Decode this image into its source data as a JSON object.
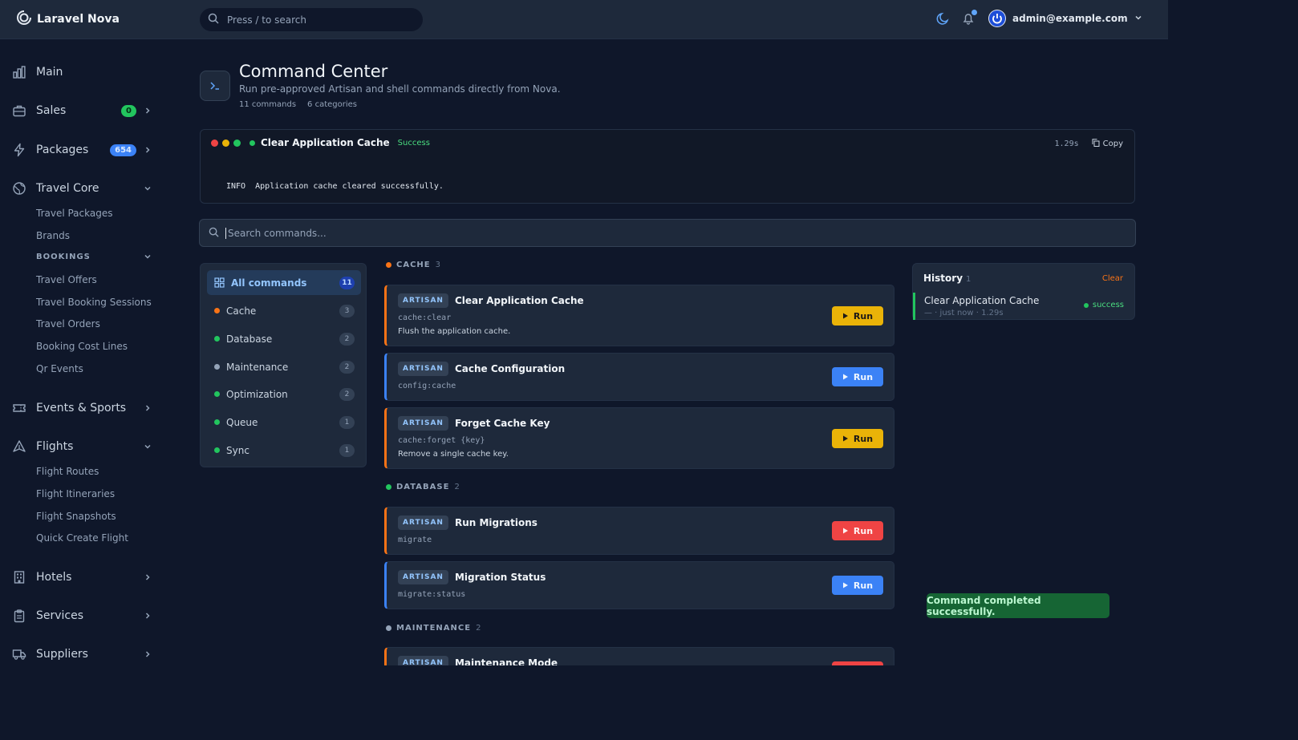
{
  "app": {
    "name": "Laravel Nova"
  },
  "topbar": {
    "search_placeholder": "Press / to search",
    "user_email": "admin@example.com"
  },
  "sidebar": {
    "groups": [
      {
        "label": "Main",
        "icon": "chart-bar-icon"
      },
      {
        "label": "Sales",
        "icon": "briefcase-icon",
        "badge": "0",
        "badge_color": "#22c55e"
      },
      {
        "label": "Packages",
        "icon": "lightning-icon",
        "badge": "654",
        "badge_color": "#3b82f6"
      },
      {
        "label": "Travel Core",
        "icon": "globe-icon",
        "expanded": true
      },
      {
        "label": "Events & Sports",
        "icon": "ticket-icon"
      },
      {
        "label": "Flights",
        "icon": "plane-icon",
        "expanded": true
      },
      {
        "label": "Hotels",
        "icon": "building-icon"
      },
      {
        "label": "Services",
        "icon": "clipboard-icon"
      },
      {
        "label": "Suppliers",
        "icon": "truck-icon"
      }
    ],
    "travel_core_items": [
      "Travel Packages",
      "Brands"
    ],
    "bookings_heading": "BOOKINGS",
    "bookings_items": [
      "Travel Offers",
      "Travel Booking Sessions",
      "Travel Orders",
      "Booking Cost Lines",
      "Qr Events"
    ],
    "flights_items": [
      "Flight Routes",
      "Flight Itineraries",
      "Flight Snapshots",
      "Quick Create Flight"
    ]
  },
  "header": {
    "title": "Command Center",
    "subtitle": "Run pre-approved Artisan and shell commands directly from Nova.",
    "commands_count": "11 commands",
    "categories_count": "6 categories"
  },
  "terminal": {
    "title": "Clear Application Cache",
    "status": "Success",
    "duration": "1.29s",
    "copy_label": "Copy",
    "output_level": "INFO",
    "output_text": "Application cache cleared successfully."
  },
  "command_search": {
    "placeholder": "Search commands..."
  },
  "categories": [
    {
      "label": "All commands",
      "count": "11",
      "active": true
    },
    {
      "label": "Cache",
      "count": "3",
      "color": "#f97316"
    },
    {
      "label": "Database",
      "count": "2",
      "color": "#22c55e"
    },
    {
      "label": "Maintenance",
      "count": "2",
      "color": "#94a3b8"
    },
    {
      "label": "Optimization",
      "count": "2",
      "color": "#22c55e"
    },
    {
      "label": "Queue",
      "count": "1",
      "color": "#22c55e"
    },
    {
      "label": "Sync",
      "count": "1",
      "color": "#22c55e"
    }
  ],
  "sections": [
    {
      "name": "CACHE",
      "count": "3",
      "color": "#f97316"
    },
    {
      "name": "DATABASE",
      "count": "2",
      "color": "#22c55e"
    },
    {
      "name": "MAINTENANCE",
      "count": "2",
      "color": "#94a3b8"
    }
  ],
  "commands": [
    {
      "tag": "ARTISAN",
      "name": "Clear Application Cache",
      "signature": "cache:clear",
      "description": "Flush the application cache.",
      "run": "Run",
      "accent": "#f97316",
      "button": "amber"
    },
    {
      "tag": "ARTISAN",
      "name": "Cache Configuration",
      "signature": "config:cache",
      "description": "",
      "run": "Run",
      "accent": "#3b82f6",
      "button": "blue"
    },
    {
      "tag": "ARTISAN",
      "name": "Forget Cache Key",
      "signature": "cache:forget {key}",
      "description": "Remove a single cache key.",
      "run": "Run",
      "accent": "#f97316",
      "button": "amber"
    },
    {
      "tag": "ARTISAN",
      "name": "Run Migrations",
      "signature": "migrate",
      "description": "",
      "run": "Run",
      "accent": "#f97316",
      "button": "red"
    },
    {
      "tag": "ARTISAN",
      "name": "Migration Status",
      "signature": "migrate:status",
      "description": "",
      "run": "Run",
      "accent": "#3b82f6",
      "button": "blue"
    },
    {
      "tag": "ARTISAN",
      "name": "Maintenance Mode",
      "signature": "",
      "description": "",
      "run": "",
      "accent": "#f97316",
      "button": "red"
    }
  ],
  "history": {
    "title": "History",
    "count": "1",
    "clear_label": "Clear",
    "items": [
      {
        "name": "Clear Application Cache",
        "meta": "— · just now · 1.29s",
        "status": "success"
      }
    ]
  },
  "toast": {
    "message": "Command completed successfully."
  }
}
